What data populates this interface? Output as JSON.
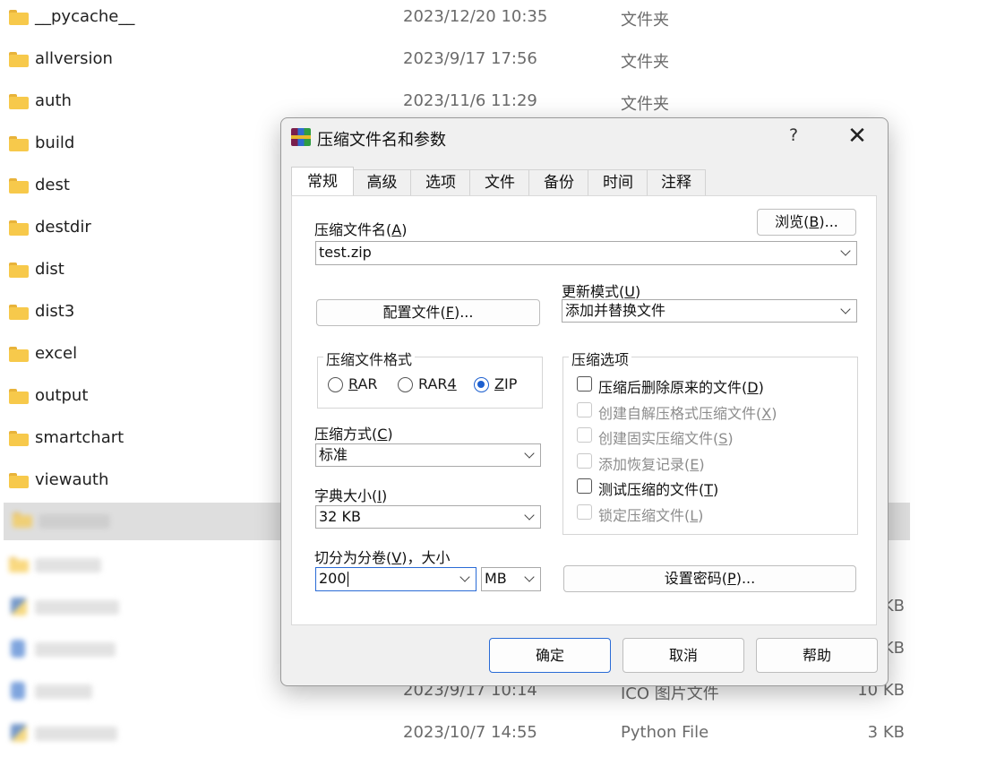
{
  "explorer": {
    "rows": [
      {
        "name": "__pycache__",
        "date": "2023/12/20 10:35",
        "type": "文件夹",
        "size": ""
      },
      {
        "name": "allversion",
        "date": "2023/9/17 17:56",
        "type": "文件夹",
        "size": ""
      },
      {
        "name": "auth",
        "date": "2023/11/6 11:29",
        "type": "文件夹",
        "size": ""
      },
      {
        "name": "build",
        "date": "",
        "type": "",
        "size": ""
      },
      {
        "name": "dest",
        "date": "",
        "type": "",
        "size": ""
      },
      {
        "name": "destdir",
        "date": "",
        "type": "",
        "size": ""
      },
      {
        "name": "dist",
        "date": "",
        "type": "",
        "size": ""
      },
      {
        "name": "dist3",
        "date": "",
        "type": "",
        "size": ""
      },
      {
        "name": "excel",
        "date": "",
        "type": "",
        "size": ""
      },
      {
        "name": "output",
        "date": "",
        "type": "",
        "size": ""
      },
      {
        "name": "smartchart",
        "date": "",
        "type": "",
        "size": ""
      },
      {
        "name": "viewauth",
        "date": "",
        "type": "",
        "size": ""
      },
      {
        "name": "",
        "date": "",
        "type": "",
        "size": ""
      },
      {
        "name": "",
        "date": "",
        "type": "",
        "size": ""
      },
      {
        "name": "",
        "date": "",
        "type": "",
        "size": "KB"
      },
      {
        "name": "",
        "date": "",
        "type": "",
        "size": "KB"
      },
      {
        "name": "",
        "date": "2023/9/17 10:14",
        "type": "ICO 图片文件",
        "size": "10 KB"
      },
      {
        "name": "",
        "date": "2023/10/7 14:55",
        "type": "Python File",
        "size": "3 KB"
      }
    ]
  },
  "dialog": {
    "title": "压缩文件名和参数",
    "help": "?",
    "close": "✕",
    "tabs": [
      "常规",
      "高级",
      "选项",
      "文件",
      "备份",
      "时间",
      "注释"
    ],
    "archive_name_label": "压缩文件名(",
    "archive_name_key": "A",
    "archive_name_close": ")",
    "browse_button": "浏览(",
    "browse_key": "B",
    "browse_tail": ")...",
    "archive_name_value": "test.zip",
    "profile_button": "配置文件(",
    "profile_key": "F",
    "profile_tail": ")...",
    "update_mode_label": "更新模式(",
    "update_mode_key": "U",
    "update_mode_close": ")",
    "update_mode_value": "添加并替换文件",
    "format_group": "压缩文件格式",
    "formats": [
      {
        "key": "R",
        "rest": "AR",
        "checked": false
      },
      {
        "key": "",
        "rest": "RAR",
        "key2": "4",
        "checked": false
      },
      {
        "key": "Z",
        "rest": "IP",
        "checked": true
      }
    ],
    "method_label": "压缩方式(",
    "method_key": "C",
    "method_close": ")",
    "method_value": "标准",
    "dict_label": "字典大小(",
    "dict_key": "I",
    "dict_close": ")",
    "dict_value": "32 KB",
    "split_label": "切分为分卷(",
    "split_key": "V",
    "split_close": ")，大小",
    "split_value": "200",
    "split_unit": "MB",
    "options_group": "压缩选项",
    "options": [
      {
        "text": "压缩后删除原来的文件(",
        "key": "D",
        "close": ")",
        "disabled": false,
        "checked": false
      },
      {
        "text": "创建自解压格式压缩文件(",
        "key": "X",
        "close": ")",
        "disabled": true,
        "checked": false
      },
      {
        "text": "创建固实压缩文件(",
        "key": "S",
        "close": ")",
        "disabled": true,
        "checked": false
      },
      {
        "text": "添加恢复记录(",
        "key": "E",
        "close": ")",
        "disabled": true,
        "checked": false
      },
      {
        "text": "测试压缩的文件(",
        "key": "T",
        "close": ")",
        "disabled": false,
        "checked": false
      },
      {
        "text": "锁定压缩文件(",
        "key": "L",
        "close": ")",
        "disabled": true,
        "checked": false
      }
    ],
    "password_button": "设置密码(",
    "password_key": "P",
    "password_tail": ")...",
    "ok_button": "确定",
    "cancel_button": "取消",
    "help_button": "帮助"
  },
  "colors": {
    "accent": "#1c5fcf",
    "folder": "#f7c94b",
    "selected_row": "#dedede"
  }
}
